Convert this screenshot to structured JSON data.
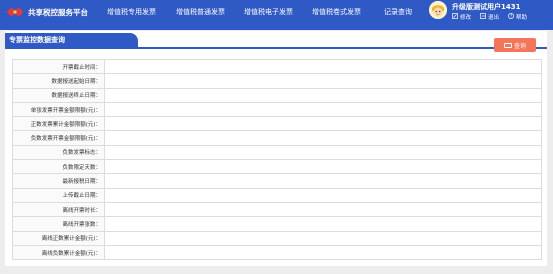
{
  "header": {
    "title": "共享税控服务平台",
    "nav": [
      "增值税专用发票",
      "增值税普通发票",
      "增值税电子发票",
      "增值税卷式发票",
      "记录查询"
    ],
    "user": {
      "name": "升级版测试用户1431",
      "links": [
        "修改",
        "退出",
        "帮助"
      ]
    }
  },
  "panel": {
    "title": "专票监控数据查询",
    "query_label": "查询",
    "rows": [
      {
        "label": "开票截止时间：",
        "value": ""
      },
      {
        "label": "数据报送起始日期：",
        "value": ""
      },
      {
        "label": "数据报送终止日期：",
        "value": ""
      },
      {
        "label": "单张发票开票金额限额(元)：",
        "value": ""
      },
      {
        "label": "正数发票累计金额限额(元)：",
        "value": ""
      },
      {
        "label": "负数发票开票金额限额(元)：",
        "value": ""
      },
      {
        "label": "负数发票标志：",
        "value": ""
      },
      {
        "label": "负数限定天数：",
        "value": ""
      },
      {
        "label": "最新报税日期：",
        "value": ""
      },
      {
        "label": "上传截止日期：",
        "value": ""
      },
      {
        "label": "离线开票时长：",
        "value": ""
      },
      {
        "label": "离线开票张数：",
        "value": ""
      },
      {
        "label": "离线正数累计金额(元)：",
        "value": ""
      },
      {
        "label": "离线负数累计金额(元)：",
        "value": ""
      }
    ]
  },
  "colors": {
    "header_bg": "#2f59c4",
    "query_button": "#f47559"
  }
}
